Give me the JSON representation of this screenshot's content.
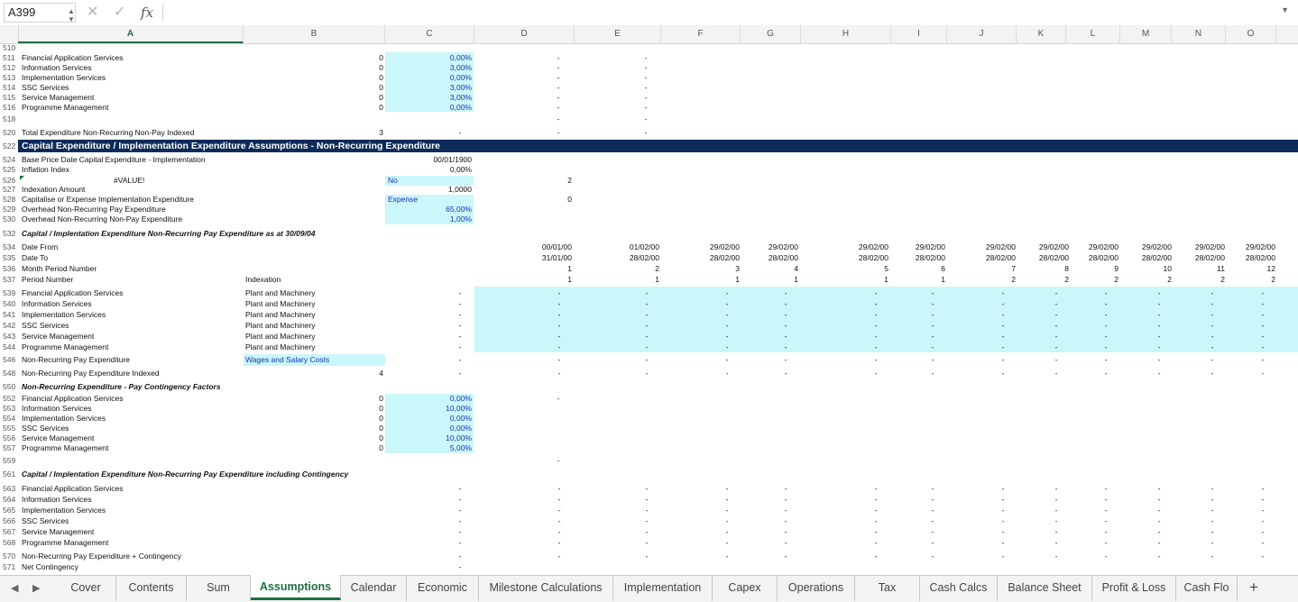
{
  "formula_bar": {
    "name_box": "A399",
    "cancel_icon": "✕",
    "confirm_icon": "✓",
    "fx_label": "fx",
    "formula": ""
  },
  "columns": [
    "A",
    "B",
    "C",
    "D",
    "E",
    "F",
    "G",
    "H",
    "I",
    "J",
    "K",
    "L",
    "M",
    "N",
    "O"
  ],
  "active_column": "A",
  "sheet": {
    "r510": {
      "num": "510"
    },
    "items1": [
      {
        "num": "511",
        "label": "Financial Application Services",
        "b": "0",
        "c": "0,00%",
        "d": "-",
        "e": "-"
      },
      {
        "num": "512",
        "label": "Information Services",
        "b": "0",
        "c": "3,00%",
        "d": "-",
        "e": "-"
      },
      {
        "num": "513",
        "label": "Implementation Services",
        "b": "0",
        "c": "0,00%",
        "d": "-",
        "e": "-"
      },
      {
        "num": "514",
        "label": "SSC Services",
        "b": "0",
        "c": "3,00%",
        "d": "-",
        "e": "-"
      },
      {
        "num": "515",
        "label": "Service Management",
        "b": "0",
        "c": "3,00%",
        "d": "-",
        "e": "-"
      },
      {
        "num": "516",
        "label": "Programme Management",
        "b": "0",
        "c": "0,00%",
        "d": "-",
        "e": "-"
      }
    ],
    "r518": {
      "num": "518",
      "d": "-",
      "e": "-"
    },
    "r520": {
      "num": "520",
      "label": "Total Expenditure Non-Recurring Non-Pay Indexed",
      "b": "3",
      "c": "-",
      "d": "-",
      "e": "-"
    },
    "r522": {
      "num": "522",
      "label": "Capital Expenditure / Implementation Expenditure Assumptions - Non-Recurring Expenditure"
    },
    "r524": {
      "num": "524",
      "label": "Base Price Date Capital Expenditure - Implementation",
      "c": "00/01/1900"
    },
    "r525": {
      "num": "525",
      "label": "Inflation Index",
      "c": "0,00%"
    },
    "r526": {
      "num": "526",
      "label": "#VALUE!",
      "c": "No",
      "d": "2"
    },
    "r527": {
      "num": "527",
      "label": "Indexation Amount",
      "c": "1,0000"
    },
    "r528": {
      "num": "528",
      "label": "Capitalise or Expense Implementation Expenditure",
      "c": "Expense",
      "d": "0"
    },
    "r529": {
      "num": "529",
      "label": "Overhead Non-Recurring Pay Expenditure",
      "c": "65,00%"
    },
    "r530": {
      "num": "530",
      "label": "Overhead Non-Recurring Non-Pay Expenditure",
      "c": "1,00%"
    },
    "r532": {
      "num": "532",
      "label": "Capital / Implentation Expenditure Non-Recurring Pay Expenditure as at 30/09/04"
    },
    "r534": {
      "num": "534",
      "label": "Date From",
      "values": [
        "00/01/00",
        "01/02/00",
        "29/02/00",
        "29/02/00",
        "29/02/00",
        "29/02/00",
        "29/02/00",
        "29/02/00",
        "29/02/00",
        "29/02/00",
        "29/02/00",
        "29/02/00"
      ]
    },
    "r535": {
      "num": "535",
      "label": "Date To",
      "values": [
        "31/01/00",
        "28/02/00",
        "28/02/00",
        "28/02/00",
        "28/02/00",
        "28/02/00",
        "28/02/00",
        "28/02/00",
        "28/02/00",
        "28/02/00",
        "28/02/00",
        "28/02/00"
      ]
    },
    "r536": {
      "num": "536",
      "label": "Month Period Number",
      "values": [
        "1",
        "2",
        "3",
        "4",
        "5",
        "6",
        "7",
        "8",
        "9",
        "10",
        "11",
        "12"
      ]
    },
    "r537": {
      "num": "537",
      "label": "Period Number",
      "b": "Indexation",
      "values": [
        "1",
        "1",
        "1",
        "1",
        "1",
        "1",
        "2",
        "2",
        "2",
        "2",
        "2",
        "2"
      ]
    },
    "items2": [
      {
        "num": "539",
        "label": "Financial Application Services",
        "b": "Plant and Machinery",
        "c": "-"
      },
      {
        "num": "540",
        "label": "Information Services",
        "b": "Plant and Machinery",
        "c": "-"
      },
      {
        "num": "541",
        "label": "Implementation Services",
        "b": "Plant and Machinery",
        "c": "-"
      },
      {
        "num": "542",
        "label": "SSC Services",
        "b": "Plant and Machinery",
        "c": "-"
      },
      {
        "num": "543",
        "label": "Service Management",
        "b": "Plant and Machinery",
        "c": "-"
      },
      {
        "num": "544",
        "label": "Programme Management",
        "b": "Plant and Machinery",
        "c": "-"
      }
    ],
    "r546": {
      "num": "546",
      "label": "Non-Recurring Pay Expenditure",
      "b": "Wages and Salary Costs",
      "c": "-"
    },
    "r548": {
      "num": "548",
      "label": "Non-Recurring Pay Expenditure Indexed",
      "b": "4",
      "c": "-"
    },
    "r550": {
      "num": "550",
      "label": "Non-Recurring Expenditure - Pay Contingency Factors"
    },
    "items3": [
      {
        "num": "552",
        "label": "Financial Application Services",
        "b": "0",
        "c": "0,00%",
        "d": "-"
      },
      {
        "num": "553",
        "label": "Information Services",
        "b": "0",
        "c": "10,00%",
        "d": "-"
      },
      {
        "num": "554",
        "label": "Implementation Services",
        "b": "0",
        "c": "0,00%",
        "d": "-"
      },
      {
        "num": "555",
        "label": "SSC Services",
        "b": "0",
        "c": "0,00%",
        "d": "-"
      },
      {
        "num": "556",
        "label": "Service Management",
        "b": "0",
        "c": "10,00%",
        "d": "-"
      },
      {
        "num": "557",
        "label": "Programme Management",
        "b": "0",
        "c": "5,00%",
        "d": "-"
      }
    ],
    "r559": {
      "num": "559",
      "d": "-"
    },
    "r561": {
      "num": "561",
      "label": "Capital / Implentation Expenditure Non-Recurring Pay Expenditure including Contingency"
    },
    "items4": [
      {
        "num": "563",
        "label": "Financial Application Services",
        "c": "-"
      },
      {
        "num": "564",
        "label": "Information Services",
        "c": "-"
      },
      {
        "num": "565",
        "label": "Implementation Services",
        "c": "-"
      },
      {
        "num": "566",
        "label": "SSC Services",
        "c": "-"
      },
      {
        "num": "567",
        "label": "Service Management",
        "c": "-"
      },
      {
        "num": "568",
        "label": "Programme Management",
        "c": "-"
      }
    ],
    "r570": {
      "num": "570",
      "label": "Non-Recurring Pay Expenditure + Contingency",
      "c": "-"
    },
    "r571": {
      "num": "571",
      "label": "Net Contingency",
      "c": "-"
    },
    "dash": "-"
  },
  "tabs": [
    "Cover",
    "Contents",
    "Sum",
    "Assumptions",
    "Calendar",
    "Economic",
    "Milestone Calculations",
    "Implementation",
    "Capex",
    "Operations",
    "Tax",
    "Cash Calcs",
    "Balance Sheet",
    "Profit & Loss",
    "Cash Flo"
  ],
  "active_tab": "Assumptions",
  "add_sheet": "+"
}
